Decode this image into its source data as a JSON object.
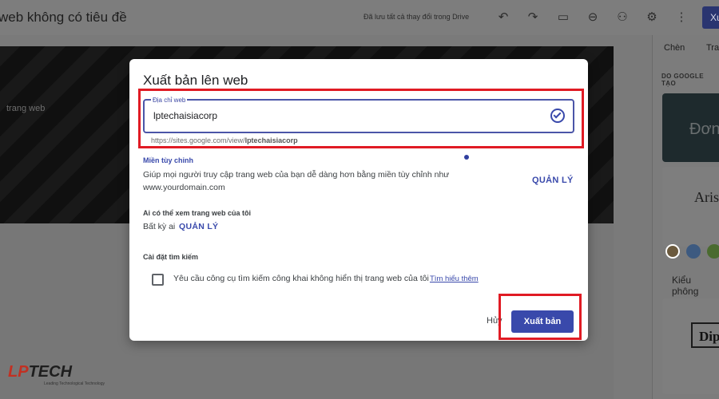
{
  "header": {
    "doc_title": "web không có tiêu đề",
    "save_status": "Đã lưu tất cả thay đổi trong Drive",
    "publish_label": "Xu"
  },
  "canvas": {
    "section_text": "trang web"
  },
  "right_panel": {
    "tabs": [
      "Chèn",
      "Tra"
    ],
    "section_label": "DO GOOGLE TẠO",
    "theme1_text": "Đơn",
    "theme2_text": "Aris",
    "theme3_text": "Dipl",
    "style_select": "Kiểu phông",
    "swatch_colors": [
      "#6b5a3e",
      "#3d5a80",
      "#4a6b2f"
    ]
  },
  "dialog": {
    "title": "Xuất bản lên web",
    "url_field": {
      "label": "Địa chỉ web",
      "value": "lptechaisiacorp",
      "hint_prefix": "https://sites.google.com/view/",
      "hint_bold": "lptechaisiacorp"
    },
    "custom_domain": {
      "title": "Miền tùy chỉnh",
      "text_line1": "Giúp mọi người truy cập trang web của bạn dễ dàng hơn bằng miền tùy chỉnh như",
      "text_line2": "www.yourdomain.com",
      "manage_label": "QUẢN LÝ"
    },
    "viewers": {
      "title": "Ai có thể xem trang web của tôi",
      "value": "Bất kỳ ai",
      "manage_label": "QUẢN LÝ"
    },
    "search": {
      "title": "Cài đặt tìm kiếm",
      "checkbox_label": "Yêu cầu công cụ tìm kiếm công khai không hiển thị trang web của tôi",
      "learn_more": "Tìm hiểu thêm"
    },
    "cancel_label": "Hủy",
    "publish_label": "Xuất bản"
  },
  "logo": {
    "brand_prefix": "LP",
    "brand_suffix": "TECH",
    "tagline": "Leading Technological Technology"
  },
  "colors": {
    "accent": "#3949ab",
    "highlight": "#e01b24"
  }
}
